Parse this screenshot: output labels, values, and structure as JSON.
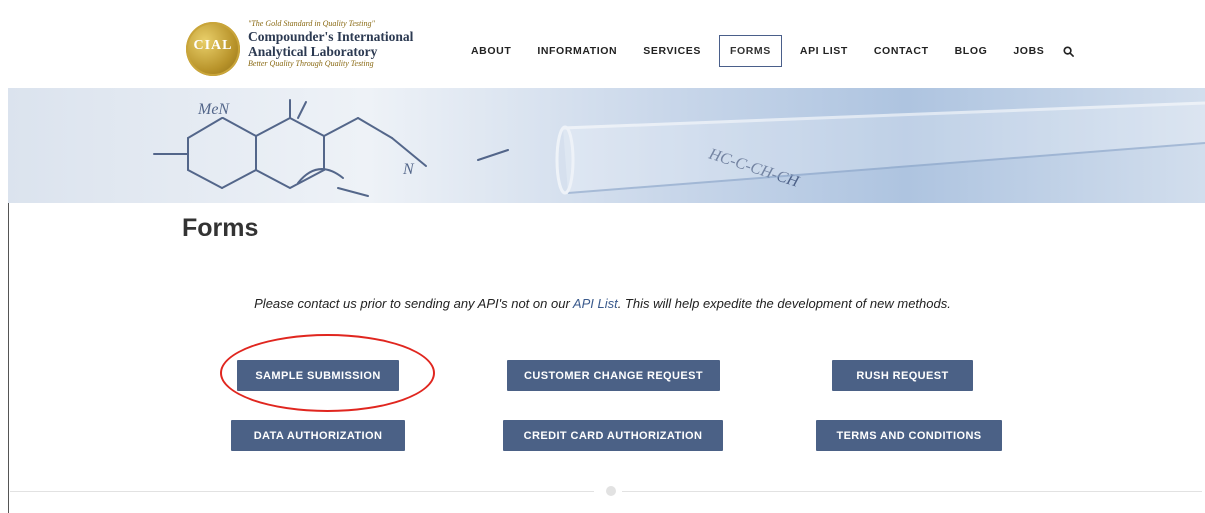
{
  "brand": {
    "seal_text": "CIAL",
    "tagline": "\"The Gold Standard in Quality Testing\"",
    "company_line1": "Compounder's International",
    "company_line2": "Analytical Laboratory",
    "subtag": "Better Quality Through Quality Testing"
  },
  "nav": {
    "items": [
      {
        "label": "ABOUT"
      },
      {
        "label": "INFORMATION"
      },
      {
        "label": "SERVICES"
      },
      {
        "label": "FORMS",
        "active": true
      },
      {
        "label": "API LIST"
      },
      {
        "label": "CONTACT"
      },
      {
        "label": "BLOG"
      },
      {
        "label": "JOBS"
      }
    ],
    "search_icon": "search-icon"
  },
  "banner": {
    "formula_left": "MeN",
    "formula_mid": "N",
    "formula_right": "HC-C-CH-CH"
  },
  "page": {
    "title": "Forms",
    "notice_pre": "Please contact us prior to sending any API's not on our ",
    "notice_link": "API List",
    "notice_post": ". This will help expedite the development of new methods."
  },
  "buttons": {
    "sample_submission": "SAMPLE SUBMISSION",
    "customer_change_request": "CUSTOMER CHANGE REQUEST",
    "rush_request": "RUSH REQUEST",
    "data_authorization": "DATA AUTHORIZATION",
    "credit_card_authorization": "CREDIT CARD AUTHORIZATION",
    "terms_and_conditions": "TERMS AND CONDITIONS"
  },
  "colors": {
    "accent": "#4b6186",
    "annotation": "#e0261f",
    "link": "#3a5a8c"
  }
}
